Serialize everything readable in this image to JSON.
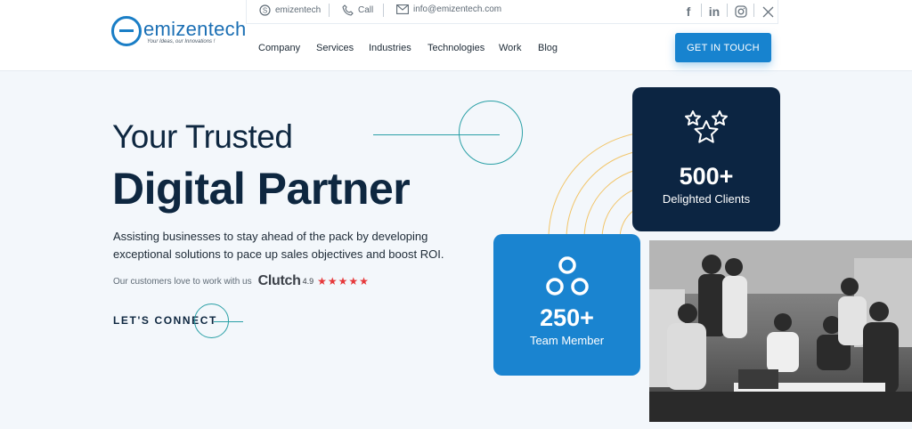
{
  "brand": {
    "name": "emizentech",
    "tagline": "Your Ideas, our Innovations !"
  },
  "topbar": {
    "skype": "emizentech",
    "call": "Call",
    "email": "info@emizentech.com"
  },
  "nav": {
    "items": [
      "Company",
      "Services",
      "Industries",
      "Technologies",
      "Work",
      "Blog"
    ],
    "cta": "GET IN TOUCH"
  },
  "hero": {
    "title_line1": "Your Trusted",
    "title_line2": "Digital Partner",
    "description": "Assisting businesses to stay ahead of the pack by developing exceptional solutions to pace up sales objectives and boost ROI.",
    "clutch_text": "Our customers love to work with us",
    "clutch_logo": "Clutch",
    "clutch_rating": "4.9",
    "stars": "★★★★★",
    "connect": "LET'S CONNECT"
  },
  "stats": {
    "clients": {
      "value": "500+",
      "label": "Delighted Clients"
    },
    "team": {
      "value": "250+",
      "label": "Team Member"
    }
  },
  "colors": {
    "accent": "#1783cf",
    "dark": "#0c2542",
    "teal": "#2aa0a6",
    "star": "#e6383a",
    "ring": "#f2c569"
  }
}
